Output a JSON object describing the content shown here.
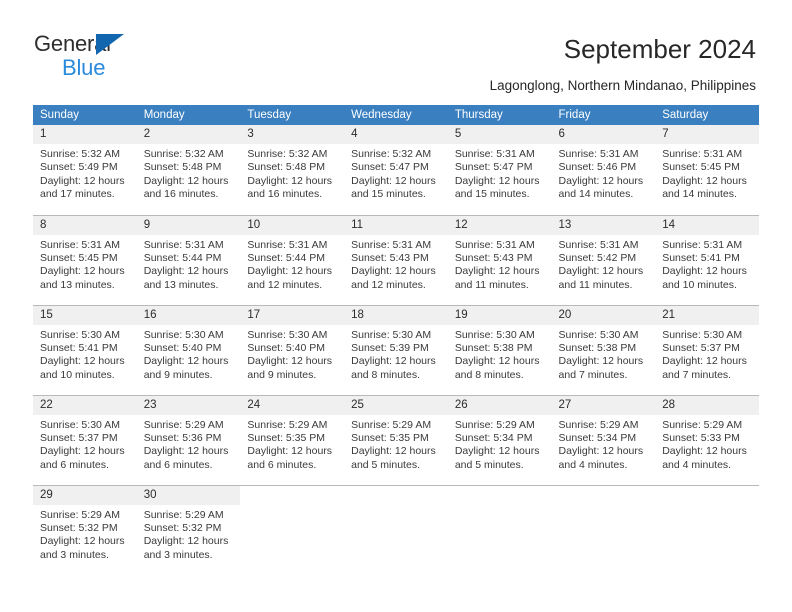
{
  "brand": {
    "name_top": "General",
    "name_bottom": "Blue",
    "accent_color": "#1266b0",
    "blue_text_color": "#2a8bdd"
  },
  "header": {
    "title": "September 2024",
    "subtitle": "Lagonglong, Northern Mindanao, Philippines"
  },
  "calendar": {
    "header_bg": "#3a7fbf",
    "daynum_bg": "#f0f0f0",
    "weekdays": [
      "Sunday",
      "Monday",
      "Tuesday",
      "Wednesday",
      "Thursday",
      "Friday",
      "Saturday"
    ],
    "weeks": [
      [
        {
          "day": "1",
          "sunrise": "Sunrise: 5:32 AM",
          "sunset": "Sunset: 5:49 PM",
          "daylight_1": "Daylight: 12 hours",
          "daylight_2": "and 17 minutes."
        },
        {
          "day": "2",
          "sunrise": "Sunrise: 5:32 AM",
          "sunset": "Sunset: 5:48 PM",
          "daylight_1": "Daylight: 12 hours",
          "daylight_2": "and 16 minutes."
        },
        {
          "day": "3",
          "sunrise": "Sunrise: 5:32 AM",
          "sunset": "Sunset: 5:48 PM",
          "daylight_1": "Daylight: 12 hours",
          "daylight_2": "and 16 minutes."
        },
        {
          "day": "4",
          "sunrise": "Sunrise: 5:32 AM",
          "sunset": "Sunset: 5:47 PM",
          "daylight_1": "Daylight: 12 hours",
          "daylight_2": "and 15 minutes."
        },
        {
          "day": "5",
          "sunrise": "Sunrise: 5:31 AM",
          "sunset": "Sunset: 5:47 PM",
          "daylight_1": "Daylight: 12 hours",
          "daylight_2": "and 15 minutes."
        },
        {
          "day": "6",
          "sunrise": "Sunrise: 5:31 AM",
          "sunset": "Sunset: 5:46 PM",
          "daylight_1": "Daylight: 12 hours",
          "daylight_2": "and 14 minutes."
        },
        {
          "day": "7",
          "sunrise": "Sunrise: 5:31 AM",
          "sunset": "Sunset: 5:45 PM",
          "daylight_1": "Daylight: 12 hours",
          "daylight_2": "and 14 minutes."
        }
      ],
      [
        {
          "day": "8",
          "sunrise": "Sunrise: 5:31 AM",
          "sunset": "Sunset: 5:45 PM",
          "daylight_1": "Daylight: 12 hours",
          "daylight_2": "and 13 minutes."
        },
        {
          "day": "9",
          "sunrise": "Sunrise: 5:31 AM",
          "sunset": "Sunset: 5:44 PM",
          "daylight_1": "Daylight: 12 hours",
          "daylight_2": "and 13 minutes."
        },
        {
          "day": "10",
          "sunrise": "Sunrise: 5:31 AM",
          "sunset": "Sunset: 5:44 PM",
          "daylight_1": "Daylight: 12 hours",
          "daylight_2": "and 12 minutes."
        },
        {
          "day": "11",
          "sunrise": "Sunrise: 5:31 AM",
          "sunset": "Sunset: 5:43 PM",
          "daylight_1": "Daylight: 12 hours",
          "daylight_2": "and 12 minutes."
        },
        {
          "day": "12",
          "sunrise": "Sunrise: 5:31 AM",
          "sunset": "Sunset: 5:43 PM",
          "daylight_1": "Daylight: 12 hours",
          "daylight_2": "and 11 minutes."
        },
        {
          "day": "13",
          "sunrise": "Sunrise: 5:31 AM",
          "sunset": "Sunset: 5:42 PM",
          "daylight_1": "Daylight: 12 hours",
          "daylight_2": "and 11 minutes."
        },
        {
          "day": "14",
          "sunrise": "Sunrise: 5:31 AM",
          "sunset": "Sunset: 5:41 PM",
          "daylight_1": "Daylight: 12 hours",
          "daylight_2": "and 10 minutes."
        }
      ],
      [
        {
          "day": "15",
          "sunrise": "Sunrise: 5:30 AM",
          "sunset": "Sunset: 5:41 PM",
          "daylight_1": "Daylight: 12 hours",
          "daylight_2": "and 10 minutes."
        },
        {
          "day": "16",
          "sunrise": "Sunrise: 5:30 AM",
          "sunset": "Sunset: 5:40 PM",
          "daylight_1": "Daylight: 12 hours",
          "daylight_2": "and 9 minutes."
        },
        {
          "day": "17",
          "sunrise": "Sunrise: 5:30 AM",
          "sunset": "Sunset: 5:40 PM",
          "daylight_1": "Daylight: 12 hours",
          "daylight_2": "and 9 minutes."
        },
        {
          "day": "18",
          "sunrise": "Sunrise: 5:30 AM",
          "sunset": "Sunset: 5:39 PM",
          "daylight_1": "Daylight: 12 hours",
          "daylight_2": "and 8 minutes."
        },
        {
          "day": "19",
          "sunrise": "Sunrise: 5:30 AM",
          "sunset": "Sunset: 5:38 PM",
          "daylight_1": "Daylight: 12 hours",
          "daylight_2": "and 8 minutes."
        },
        {
          "day": "20",
          "sunrise": "Sunrise: 5:30 AM",
          "sunset": "Sunset: 5:38 PM",
          "daylight_1": "Daylight: 12 hours",
          "daylight_2": "and 7 minutes."
        },
        {
          "day": "21",
          "sunrise": "Sunrise: 5:30 AM",
          "sunset": "Sunset: 5:37 PM",
          "daylight_1": "Daylight: 12 hours",
          "daylight_2": "and 7 minutes."
        }
      ],
      [
        {
          "day": "22",
          "sunrise": "Sunrise: 5:30 AM",
          "sunset": "Sunset: 5:37 PM",
          "daylight_1": "Daylight: 12 hours",
          "daylight_2": "and 6 minutes."
        },
        {
          "day": "23",
          "sunrise": "Sunrise: 5:29 AM",
          "sunset": "Sunset: 5:36 PM",
          "daylight_1": "Daylight: 12 hours",
          "daylight_2": "and 6 minutes."
        },
        {
          "day": "24",
          "sunrise": "Sunrise: 5:29 AM",
          "sunset": "Sunset: 5:35 PM",
          "daylight_1": "Daylight: 12 hours",
          "daylight_2": "and 6 minutes."
        },
        {
          "day": "25",
          "sunrise": "Sunrise: 5:29 AM",
          "sunset": "Sunset: 5:35 PM",
          "daylight_1": "Daylight: 12 hours",
          "daylight_2": "and 5 minutes."
        },
        {
          "day": "26",
          "sunrise": "Sunrise: 5:29 AM",
          "sunset": "Sunset: 5:34 PM",
          "daylight_1": "Daylight: 12 hours",
          "daylight_2": "and 5 minutes."
        },
        {
          "day": "27",
          "sunrise": "Sunrise: 5:29 AM",
          "sunset": "Sunset: 5:34 PM",
          "daylight_1": "Daylight: 12 hours",
          "daylight_2": "and 4 minutes."
        },
        {
          "day": "28",
          "sunrise": "Sunrise: 5:29 AM",
          "sunset": "Sunset: 5:33 PM",
          "daylight_1": "Daylight: 12 hours",
          "daylight_2": "and 4 minutes."
        }
      ],
      [
        {
          "day": "29",
          "sunrise": "Sunrise: 5:29 AM",
          "sunset": "Sunset: 5:32 PM",
          "daylight_1": "Daylight: 12 hours",
          "daylight_2": "and 3 minutes."
        },
        {
          "day": "30",
          "sunrise": "Sunrise: 5:29 AM",
          "sunset": "Sunset: 5:32 PM",
          "daylight_1": "Daylight: 12 hours",
          "daylight_2": "and 3 minutes."
        },
        {
          "day": "",
          "sunrise": "",
          "sunset": "",
          "daylight_1": "",
          "daylight_2": ""
        },
        {
          "day": "",
          "sunrise": "",
          "sunset": "",
          "daylight_1": "",
          "daylight_2": ""
        },
        {
          "day": "",
          "sunrise": "",
          "sunset": "",
          "daylight_1": "",
          "daylight_2": ""
        },
        {
          "day": "",
          "sunrise": "",
          "sunset": "",
          "daylight_1": "",
          "daylight_2": ""
        },
        {
          "day": "",
          "sunrise": "",
          "sunset": "",
          "daylight_1": "",
          "daylight_2": ""
        }
      ]
    ]
  }
}
